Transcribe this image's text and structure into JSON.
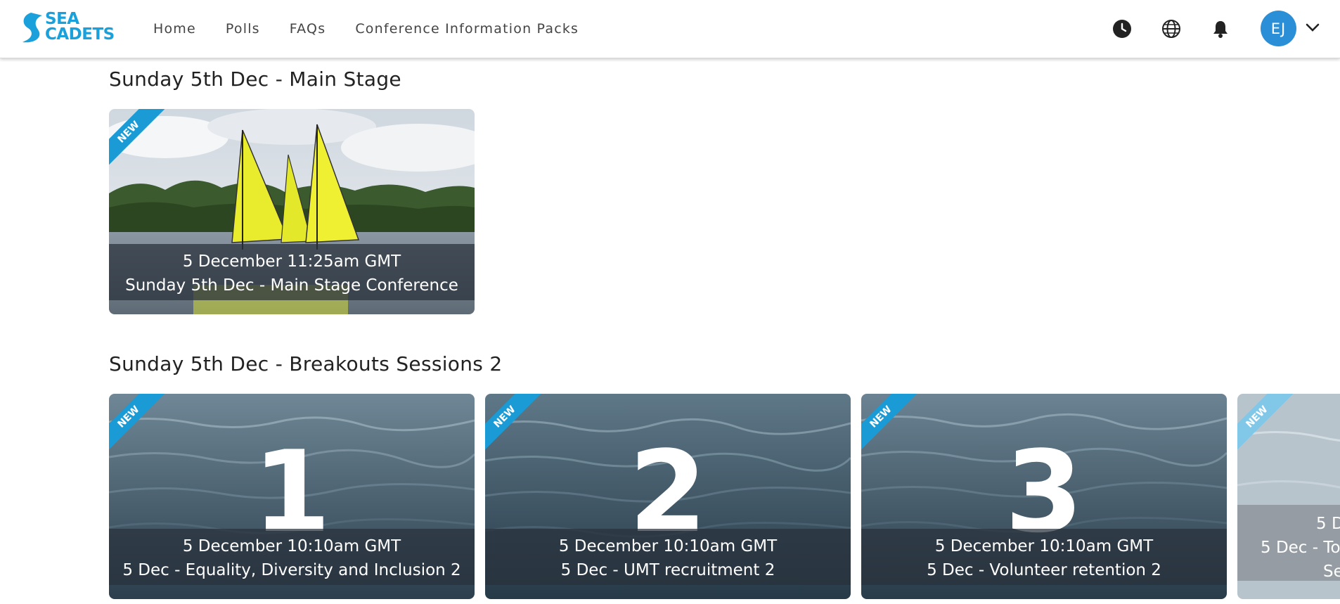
{
  "header": {
    "logo_line1": "SEA",
    "logo_line2": "CADETS",
    "nav": [
      "Home",
      "Polls",
      "FAQs",
      "Conference Information Packs"
    ],
    "icons": [
      "clock-icon",
      "globe-icon",
      "bell-icon"
    ],
    "avatar_initials": "EJ"
  },
  "sections": [
    {
      "title": "Sunday 5th Dec - Main Stage",
      "cards": [
        {
          "badge": "NEW",
          "date": "5 December 11:25am GMT",
          "title": "Sunday 5th Dec - Main Stage Conference",
          "image": "sailboats"
        }
      ]
    },
    {
      "title": "Sunday 5th Dec - Breakouts Sessions 2",
      "cards": [
        {
          "badge": "NEW",
          "number": "1",
          "date": "5 December 10:10am GMT",
          "title": "5 Dec - Equality, Diversity and Inclusion 2",
          "image": "sea"
        },
        {
          "badge": "NEW",
          "number": "2",
          "date": "5 December 10:10am GMT",
          "title": "5 Dec - UMT recruitment 2",
          "image": "sea"
        },
        {
          "badge": "NEW",
          "number": "3",
          "date": "5 December 10:10am GMT",
          "title": "5 Dec - Volunteer retention 2",
          "image": "sea"
        },
        {
          "badge": "NEW",
          "date": "5 D",
          "title": "5 Dec - To",
          "title_cont": "Se",
          "image": "sea"
        }
      ]
    }
  ],
  "colors": {
    "brand": "#1aa0db",
    "avatar": "#2b8fd8",
    "ribbon": "#1a9bd6"
  }
}
